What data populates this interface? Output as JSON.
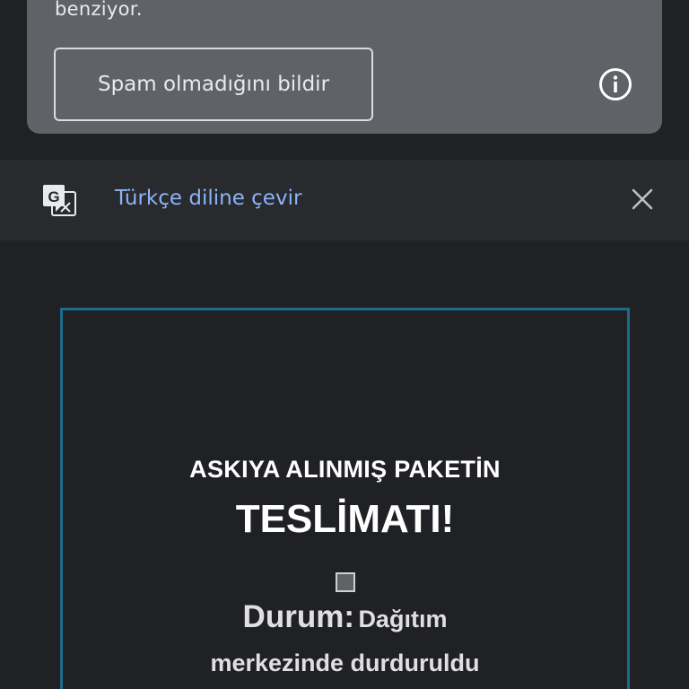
{
  "spam_card": {
    "partial_text": "benziyor.",
    "button_label": "Spam olmadığını bildir",
    "info_icon": "info-icon"
  },
  "translate_bar": {
    "link_label": "Türkçe diline çevir",
    "translate_icon": "google-translate-icon",
    "close_icon": "close-icon"
  },
  "email_body": {
    "headline_line1": "ASKIYA ALINMIŞ PAKETİN",
    "headline_line2": "TESLİMATI!",
    "status_label": "Durum:",
    "status_value_part1": "Dağıtım",
    "status_value_part2": "merkezinde durduruldu"
  },
  "colors": {
    "background": "#202124",
    "card": "#5f6368",
    "translate_bar": "#292a2d",
    "link": "#8ab4f8",
    "email_border": "#1b6e8a"
  }
}
